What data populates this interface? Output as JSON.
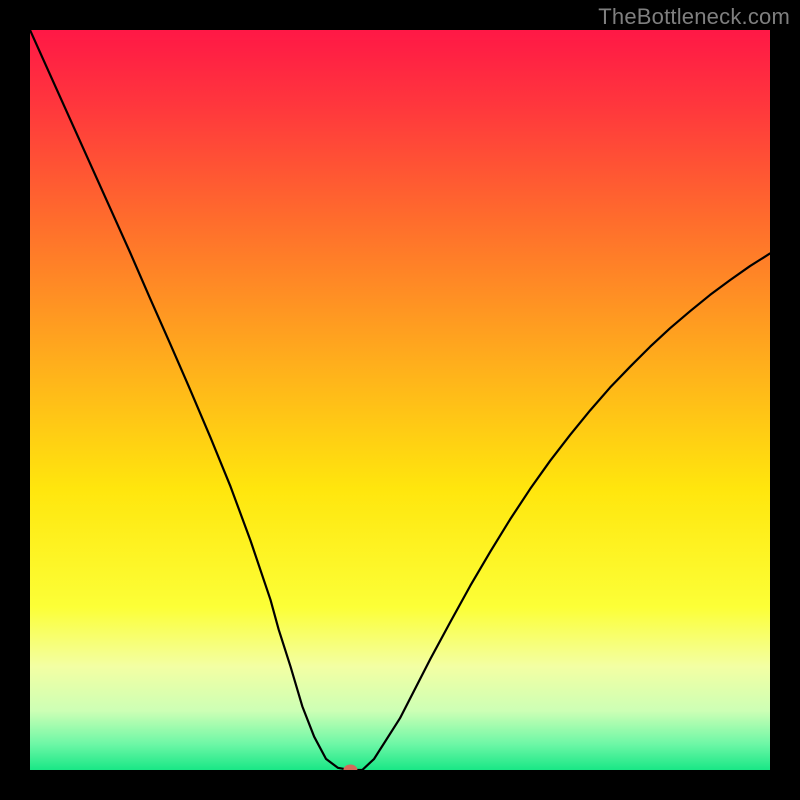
{
  "watermark": "TheBottleneck.com",
  "chart_data": {
    "type": "line",
    "title": "",
    "xlabel": "",
    "ylabel": "",
    "xlim": [
      0,
      100
    ],
    "ylim": [
      0,
      100
    ],
    "grid": false,
    "legend": false,
    "background_gradient_stops": [
      {
        "offset": 0.0,
        "color": "#ff1846"
      },
      {
        "offset": 0.1,
        "color": "#ff363d"
      },
      {
        "offset": 0.25,
        "color": "#ff6a2d"
      },
      {
        "offset": 0.45,
        "color": "#ffae1c"
      },
      {
        "offset": 0.62,
        "color": "#ffe60d"
      },
      {
        "offset": 0.78,
        "color": "#fcff37"
      },
      {
        "offset": 0.86,
        "color": "#f3ffa3"
      },
      {
        "offset": 0.92,
        "color": "#cdffb5"
      },
      {
        "offset": 0.965,
        "color": "#6df7a6"
      },
      {
        "offset": 1.0,
        "color": "#19e786"
      }
    ],
    "series": [
      {
        "name": "bottleneck-curve",
        "x": [
          0.0,
          2.7,
          5.4,
          8.1,
          10.8,
          13.5,
          16.2,
          18.9,
          21.6,
          24.4,
          27.1,
          29.8,
          32.5,
          33.6,
          35.2,
          36.8,
          38.4,
          40.0,
          41.6,
          43.2,
          44.9,
          46.5,
          50.0,
          54.1,
          56.8,
          59.5,
          62.2,
          64.9,
          67.6,
          70.3,
          73.0,
          75.7,
          78.4,
          81.1,
          83.8,
          86.5,
          89.2,
          91.9,
          94.6,
          97.3,
          100.0
        ],
        "y": [
          100.0,
          94.0,
          88.0,
          82.0,
          76.0,
          70.0,
          63.8,
          57.7,
          51.5,
          44.9,
          38.3,
          31.0,
          23.0,
          19.0,
          14.0,
          8.6,
          4.5,
          1.5,
          0.3,
          0.0,
          0.0,
          1.5,
          7.0,
          15.0,
          20.0,
          24.9,
          29.5,
          33.9,
          38.0,
          41.8,
          45.3,
          48.6,
          51.7,
          54.5,
          57.2,
          59.7,
          62.0,
          64.2,
          66.2,
          68.1,
          69.8
        ]
      }
    ],
    "marker": {
      "x": 43.3,
      "y": 0.0,
      "color": "#d46a5b"
    }
  }
}
